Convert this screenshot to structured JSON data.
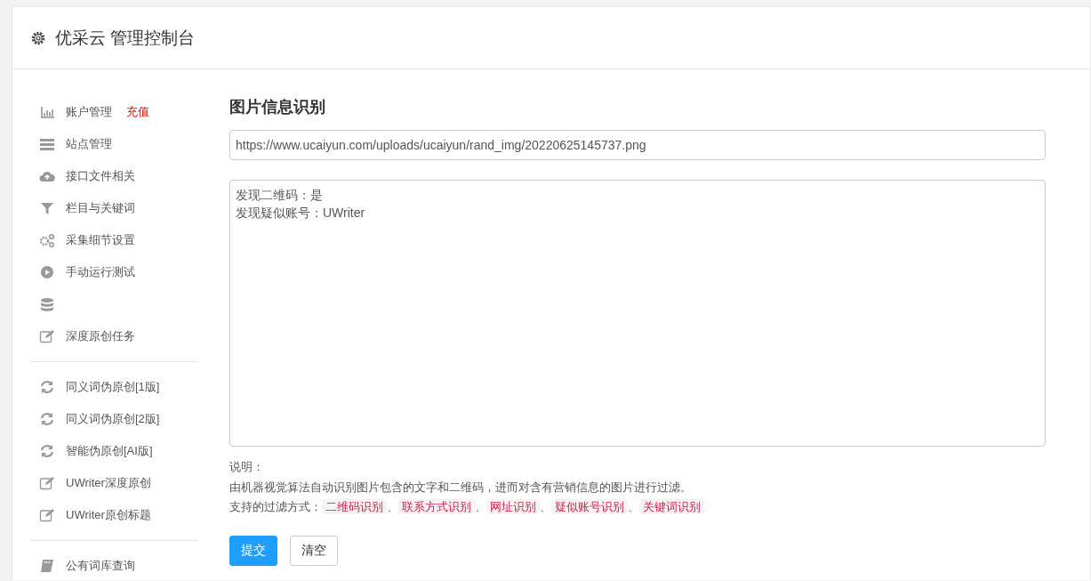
{
  "header": {
    "title": "优采云 管理控制台"
  },
  "sidebar": {
    "groups": [
      {
        "items": [
          {
            "kind": "bars",
            "label": "账户管理",
            "badge": "充值"
          },
          {
            "kind": "server",
            "label": "站点管理"
          },
          {
            "kind": "cloud",
            "label": "接口文件相关"
          },
          {
            "kind": "filter",
            "label": "栏目与关键词"
          },
          {
            "kind": "gears",
            "label": "采集细节设置"
          },
          {
            "kind": "play",
            "label": "手动运行测试"
          },
          {
            "kind": "database"
          },
          {
            "kind": "edit",
            "label": "深度原创任务"
          }
        ]
      },
      {
        "items": [
          {
            "kind": "refresh",
            "label": "同义词伪原创[1版]"
          },
          {
            "kind": "refresh",
            "label": "同义词伪原创[2版]"
          },
          {
            "kind": "refresh",
            "label": "智能伪原创[AI版]"
          },
          {
            "kind": "edit",
            "label": "UWriter深度原创"
          },
          {
            "kind": "edit",
            "label": "UWriter原创标题"
          }
        ]
      },
      {
        "items": [
          {
            "kind": "book",
            "label": "公有词库查询"
          }
        ]
      }
    ]
  },
  "main": {
    "title": "图片信息识别",
    "url_field": {
      "value": "https://www.ucaiyun.com/uploads/ucaiyun/rand_img/20220625145737.png"
    },
    "result_box": {
      "lines": [
        "发现二维码：是",
        "发现疑似账号：UWriter"
      ]
    },
    "notes": {
      "heading": "说明：",
      "description": "由机器视觉算法自动识别图片包含的文字和二维码，进而对含有营销信息的图片进行过滤。",
      "methods_label": "支持的过滤方式：",
      "separator": "、",
      "methods": [
        "二维码识别",
        "联系方式识别",
        "网址识别",
        "疑似账号识别",
        "关键词识别"
      ]
    },
    "buttons": [
      {
        "kind": "primary",
        "label": "提交"
      },
      {
        "kind": "default",
        "label": "清空"
      }
    ]
  }
}
